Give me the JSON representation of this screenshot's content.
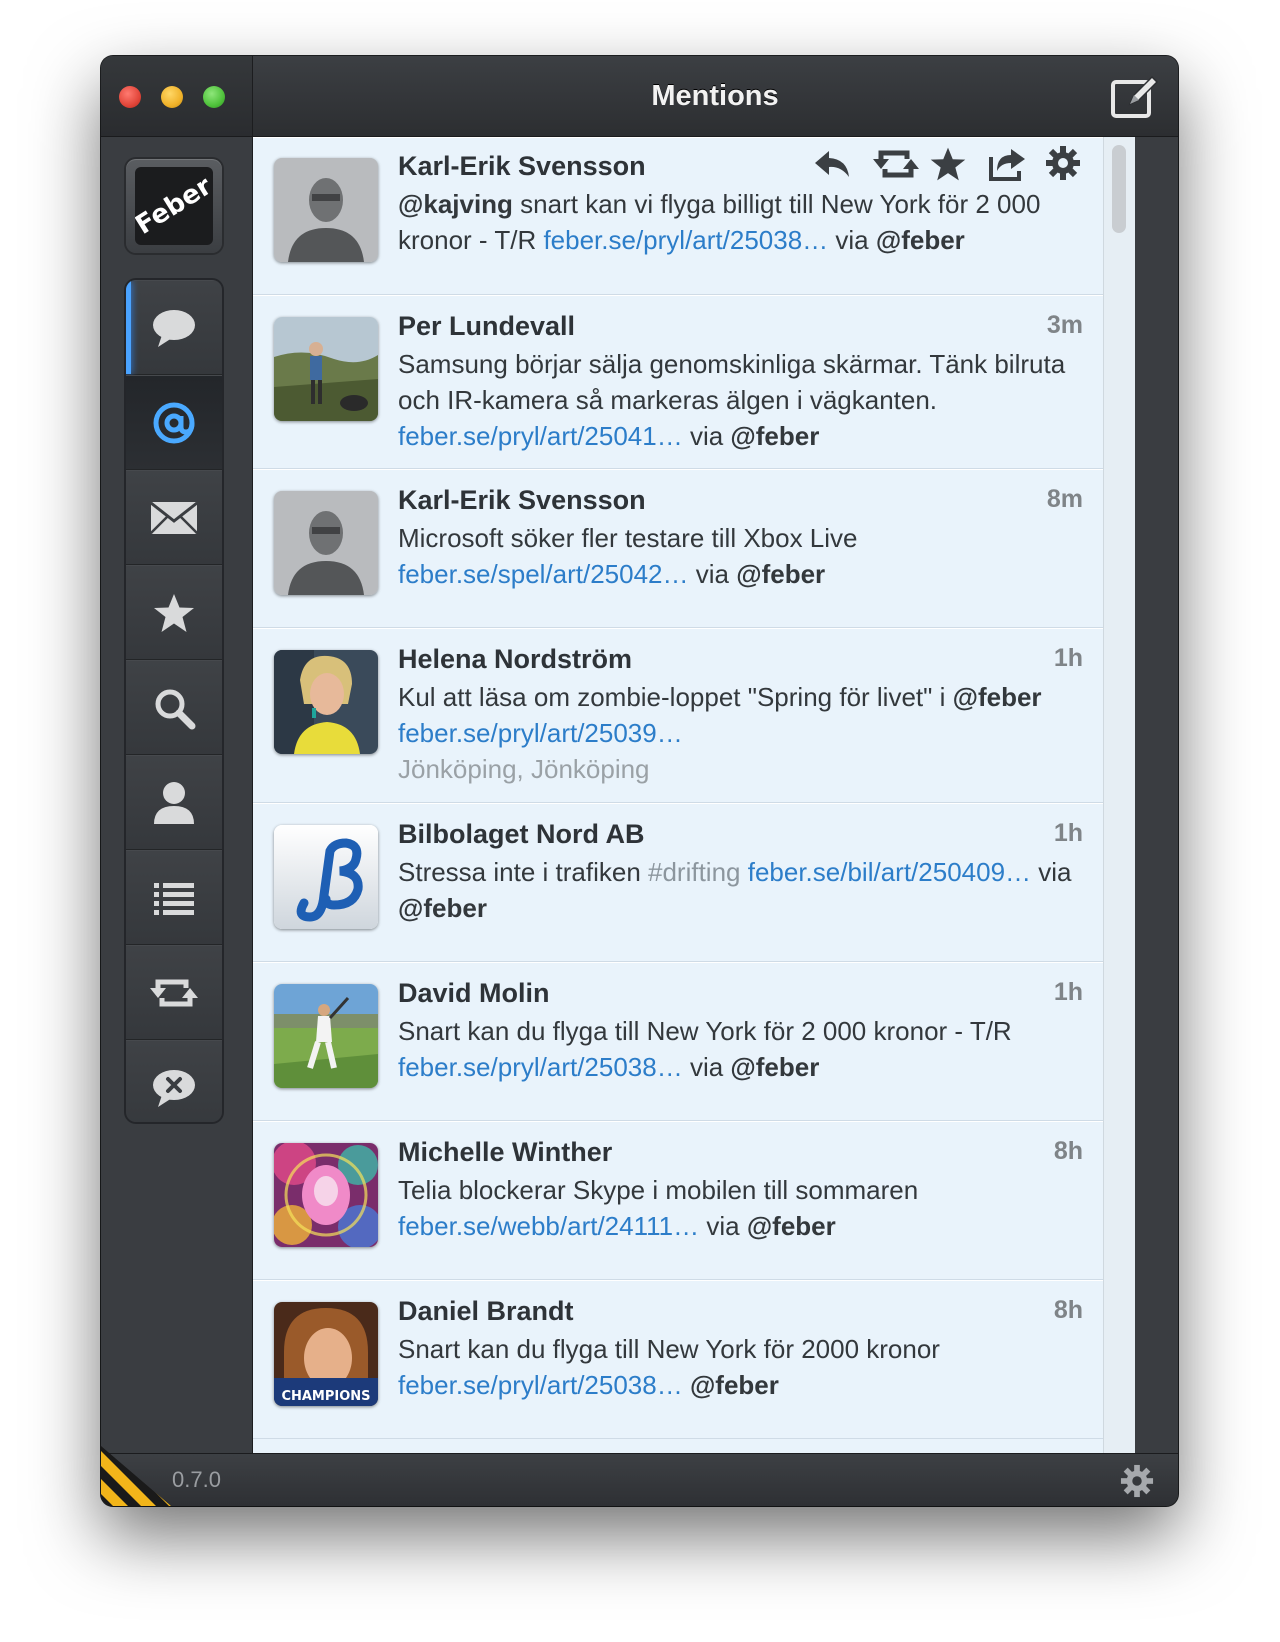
{
  "window": {
    "title": "Mentions",
    "version": "0.7.0"
  },
  "account": {
    "logo_text": "Feber"
  },
  "sidebar": {
    "items": [
      {
        "name": "timeline",
        "icon": "speech-bubble-icon"
      },
      {
        "name": "mentions",
        "icon": "at-sign-icon"
      },
      {
        "name": "messages",
        "icon": "envelope-icon"
      },
      {
        "name": "favorites",
        "icon": "star-icon"
      },
      {
        "name": "search",
        "icon": "magnifier-icon"
      },
      {
        "name": "profile",
        "icon": "person-icon"
      },
      {
        "name": "lists",
        "icon": "list-icon"
      },
      {
        "name": "retweets",
        "icon": "retweet-icon"
      },
      {
        "name": "muted",
        "icon": "muted-bubble-icon"
      }
    ]
  },
  "colors": {
    "link": "#2c7dc9",
    "feed_background": "#e9f3fb",
    "accent": "#4aa3ff"
  },
  "tweets": [
    {
      "author": "Karl-Erik Svensson",
      "time": "",
      "parts": [
        {
          "t": "@kajving",
          "style": "bold"
        },
        {
          "t": " snart kan vi flyga billigt till New York för 2 000 kronor - T/R ",
          "style": ""
        },
        {
          "t": "feber.se/pryl/art/25038…",
          "style": "link"
        },
        {
          "t": " via ",
          "style": ""
        },
        {
          "t": "@feber",
          "style": "bold"
        }
      ]
    },
    {
      "author": "Per Lundevall",
      "time": "3m",
      "parts": [
        {
          "t": "Samsung börjar sälja genomskinliga skärmar. Tänk bilruta och IR-kamera så markeras älgen i vägkanten. ",
          "style": ""
        },
        {
          "t": "feber.se/pryl/art/25041…",
          "style": "link"
        },
        {
          "t": " via ",
          "style": ""
        },
        {
          "t": "@feber",
          "style": "bold"
        }
      ]
    },
    {
      "author": "Karl-Erik Svensson",
      "time": "8m",
      "parts": [
        {
          "t": "Microsoft söker fler testare till Xbox Live ",
          "style": ""
        },
        {
          "t": "feber.se/spel/art/25042…",
          "style": "link"
        },
        {
          "t": " via ",
          "style": ""
        },
        {
          "t": "@feber",
          "style": "bold"
        }
      ]
    },
    {
      "author": "Helena Nordström",
      "time": "1h",
      "parts": [
        {
          "t": "Kul att läsa om zombie-loppet \"Spring för livet\" i ",
          "style": ""
        },
        {
          "t": "@feber",
          "style": "bold"
        },
        {
          "t": " ",
          "style": ""
        },
        {
          "t": "feber.se/pryl/art/25039…",
          "style": "link"
        }
      ],
      "place": "Jönköping, Jönköping"
    },
    {
      "author": "Bilbolaget Nord AB",
      "time": "1h",
      "parts": [
        {
          "t": "Stressa inte i trafiken ",
          "style": ""
        },
        {
          "t": "#drifting",
          "style": "hash"
        },
        {
          "t": " ",
          "style": ""
        },
        {
          "t": "feber.se/bil/art/250409…",
          "style": "link"
        },
        {
          "t": " via ",
          "style": ""
        },
        {
          "t": "@feber",
          "style": "bold"
        }
      ]
    },
    {
      "author": "David Molin",
      "time": "1h",
      "parts": [
        {
          "t": "Snart kan du flyga till New York för 2 000 kronor - T/R ",
          "style": ""
        },
        {
          "t": "feber.se/pryl/art/25038…",
          "style": "link"
        },
        {
          "t": " via ",
          "style": ""
        },
        {
          "t": "@feber",
          "style": "bold"
        }
      ]
    },
    {
      "author": "Michelle Winther",
      "time": "8h",
      "parts": [
        {
          "t": "Telia blockerar Skype i mobilen till sommaren ",
          "style": ""
        },
        {
          "t": "feber.se/webb/art/24111…",
          "style": "link"
        },
        {
          "t": " via ",
          "style": ""
        },
        {
          "t": "@feber",
          "style": "bold"
        }
      ]
    },
    {
      "author": "Daniel Brandt",
      "time": "8h",
      "parts": [
        {
          "t": "Snart kan du flyga till New York för 2000 kronor ",
          "style": ""
        },
        {
          "t": "feber.se/pryl/art/25038…",
          "style": "link"
        },
        {
          "t": " ",
          "style": ""
        },
        {
          "t": "@feber",
          "style": "bold"
        }
      ]
    }
  ],
  "avatar_badge": "CHAMPIONS"
}
